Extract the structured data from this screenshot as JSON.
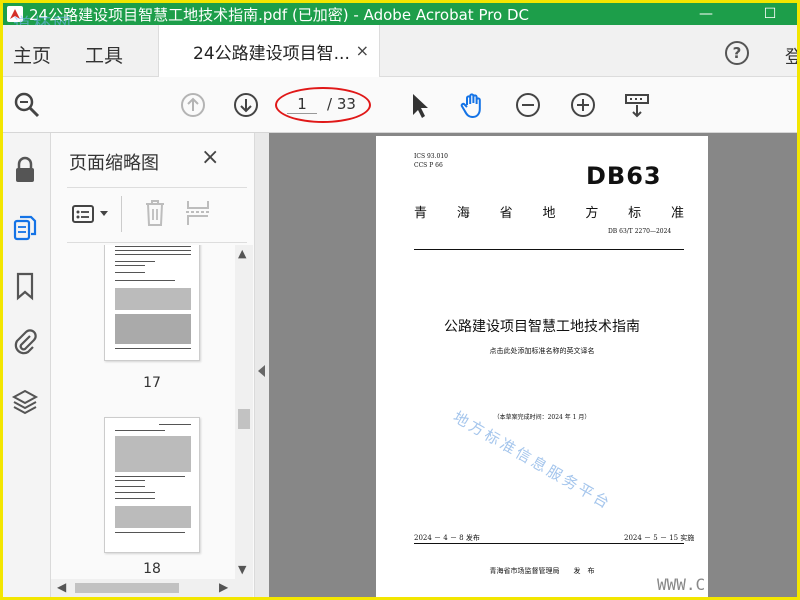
{
  "window": {
    "title": "24公路建设项目智慧工地技术指南.pdf (已加密) - Adobe Acrobat Pro DC",
    "minimize": "—",
    "maximize": "☐",
    "watermark": "道杯网"
  },
  "tabs": {
    "home": "主页",
    "tools": "工具",
    "doc_tab": "24公路建设项目智...",
    "doc_tab_close": "×",
    "help": "?",
    "login": "登"
  },
  "toolbar": {
    "current_page": "1",
    "total_pages": "/ 33"
  },
  "thumbnail_panel": {
    "title": "页面缩略图",
    "close": "×",
    "pages": [
      {
        "label": "17"
      },
      {
        "label": "18"
      }
    ]
  },
  "document": {
    "ics_code": "ICS  93.010",
    "ccs_code": "CCS  P 66",
    "db_code": "DB63",
    "standard_chars": [
      "青",
      "海",
      "省",
      "地",
      "方",
      "标",
      "准"
    ],
    "standard_number": "DB 63/T 2270—2024",
    "title": "公路建设项目智慧工地技术指南",
    "english_title_placeholder": "点击此处添加标准名称的英文译名",
    "draft_note": "（本草案完成时间：2024 年 1 月）",
    "stamp": "地方标准信息服务平台",
    "publish_date": "2024 － 4 － 8 发布",
    "implement_date": "2024 － 5 － 15 实施",
    "issuer": "青海省市场监督管理局　　发　布"
  },
  "corner_watermark": "WWW.C"
}
